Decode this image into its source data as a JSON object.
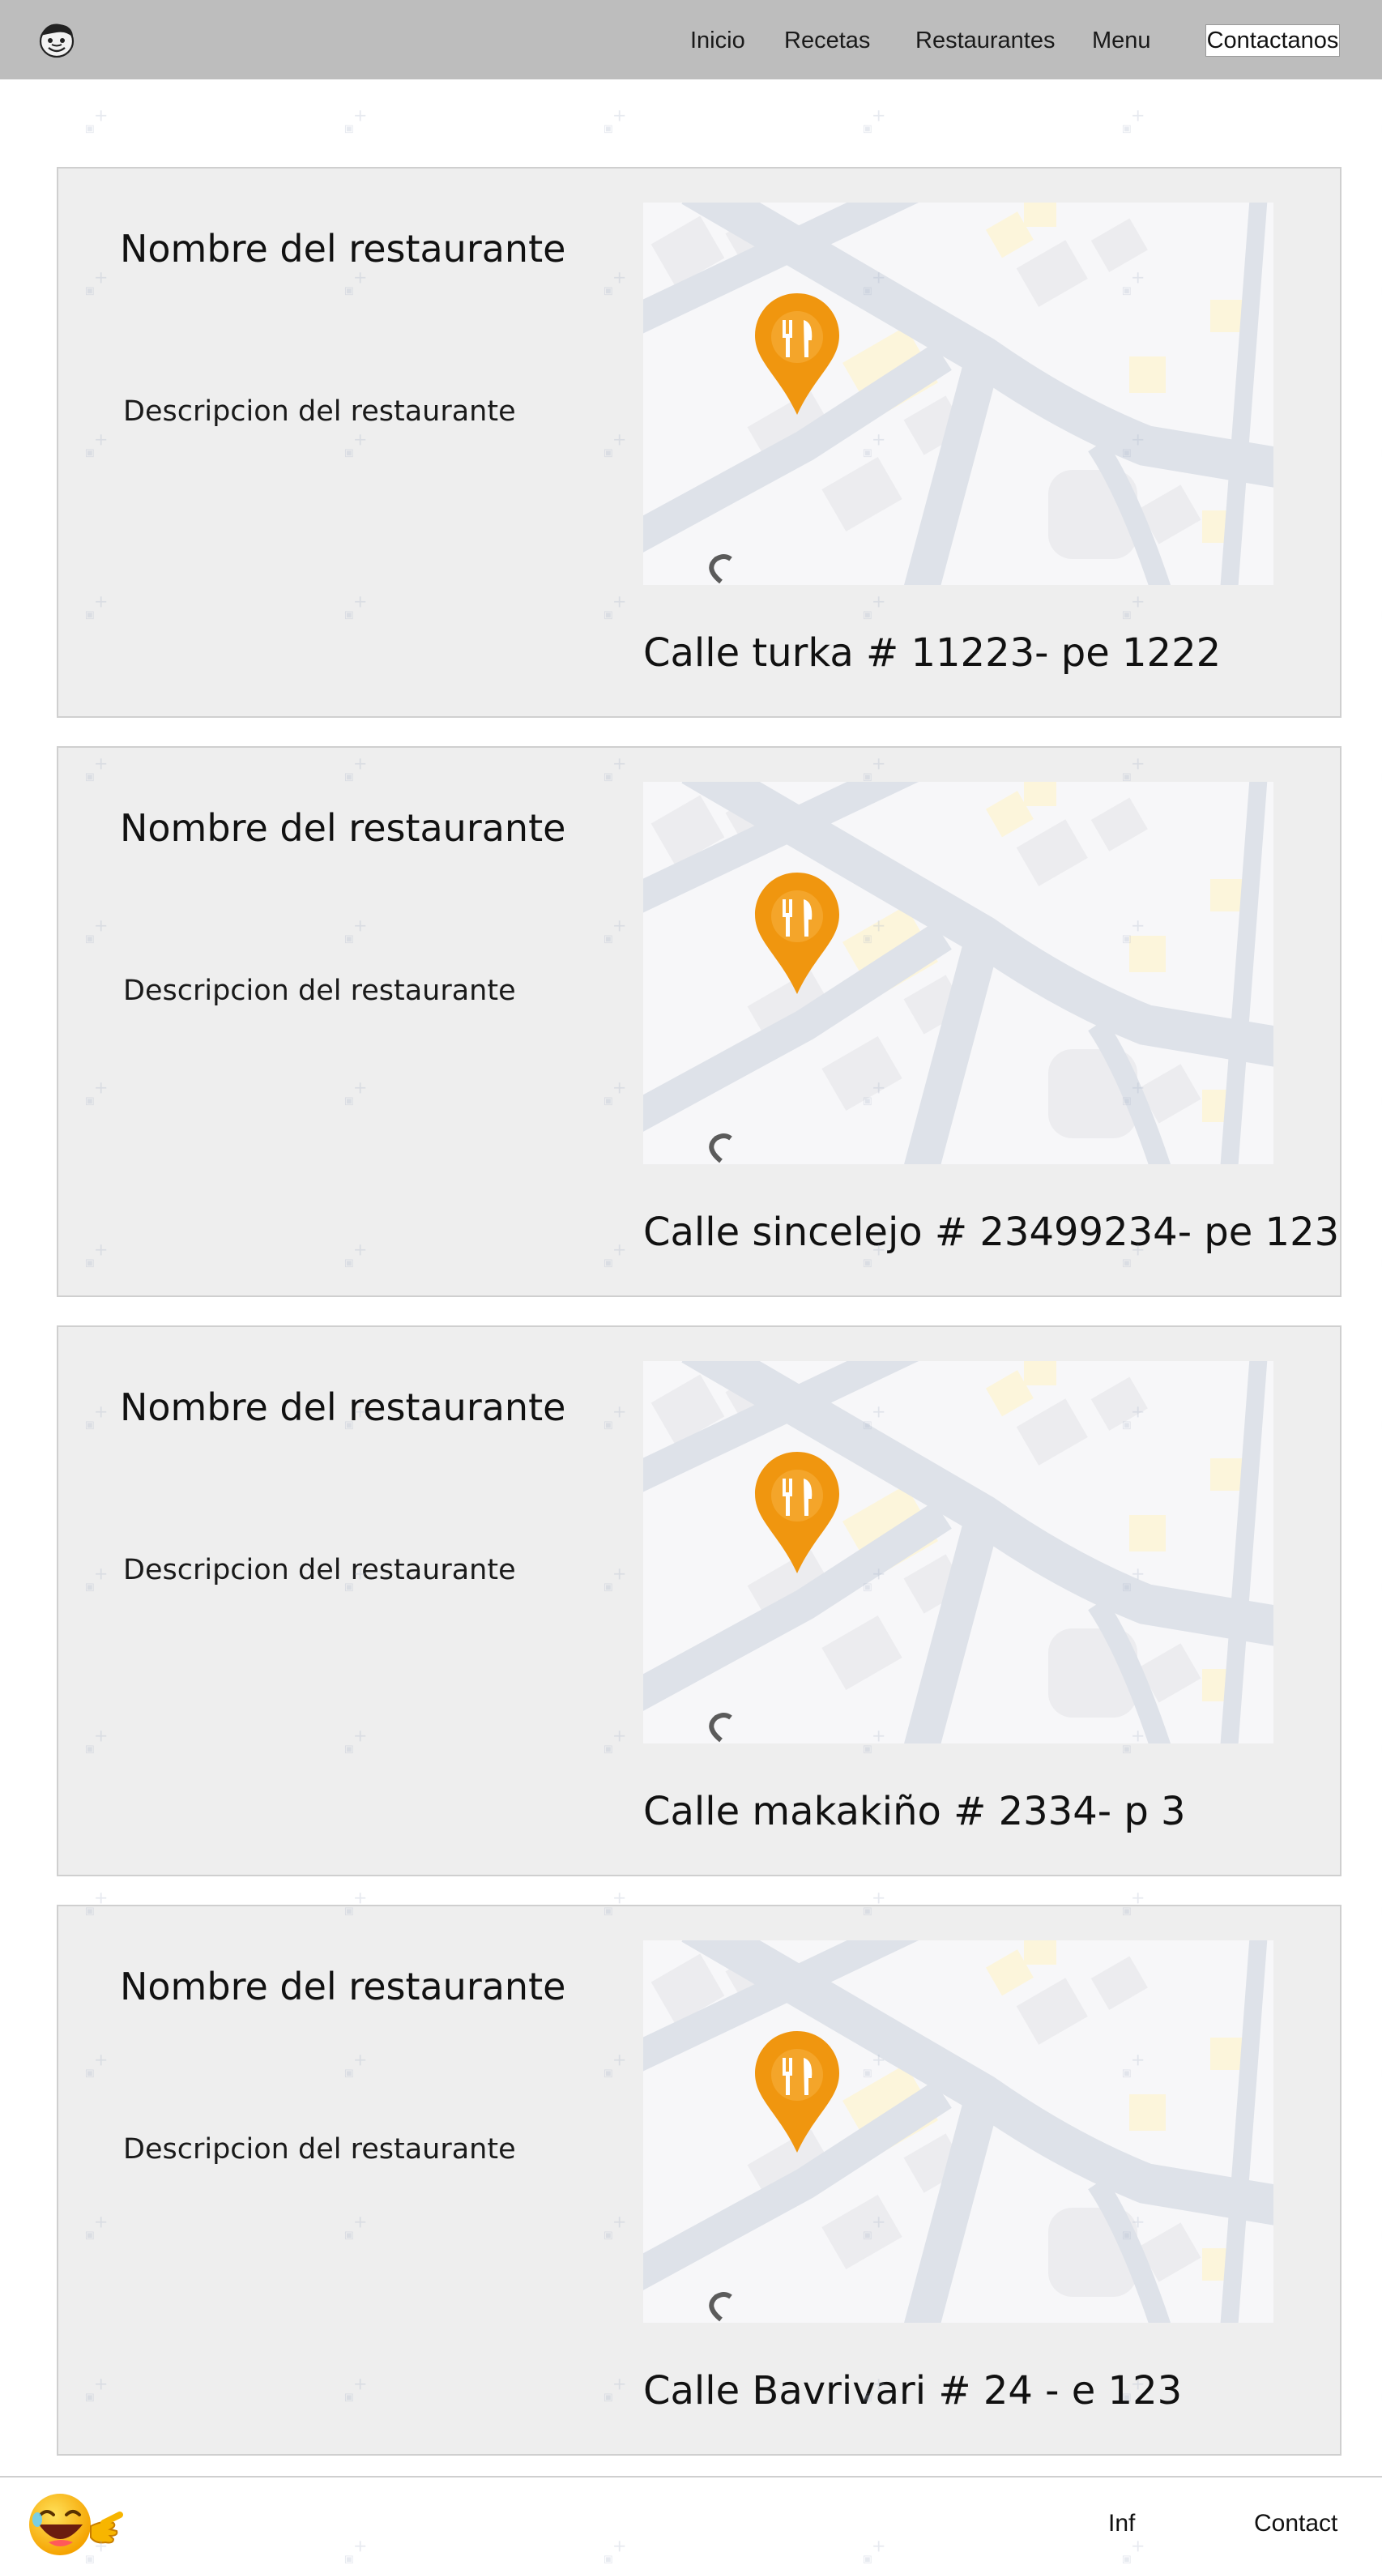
{
  "header": {
    "logo_icon": "chef-face-icon",
    "nav": [
      "Inicio",
      "Recetas",
      "Restaurantes",
      "Menu"
    ],
    "contact_label": "Contactanos"
  },
  "restaurants": [
    {
      "name": "Nombre del restaurante",
      "description": "Descripcion del restaurante",
      "address": "Calle turka # 11223- pe 1222",
      "map_icon": "restaurant-pin-icon"
    },
    {
      "name": "Nombre del restaurante",
      "description": "Descripcion del restaurante",
      "address": "Calle sincelejo # 23499234- pe 123",
      "map_icon": "restaurant-pin-icon"
    },
    {
      "name": "Nombre del restaurante",
      "description": "Descripcion del restaurante",
      "address": "Calle makakiño # 2334- p 3",
      "map_icon": "restaurant-pin-icon"
    },
    {
      "name": "Nombre del restaurante",
      "description": "Descripcion del restaurante",
      "address": "Calle Bavrivari # 24 - e 123",
      "map_icon": "restaurant-pin-icon"
    }
  ],
  "footer": {
    "emoji_icon": "laughing-emoji-icon",
    "links": [
      "Inf",
      "Contact"
    ]
  },
  "colors": {
    "topbar_bg": "#bdbdbd",
    "card_bg": "#eeeeee",
    "pin": "#f0960f",
    "map_road": "#cdd3dd"
  }
}
